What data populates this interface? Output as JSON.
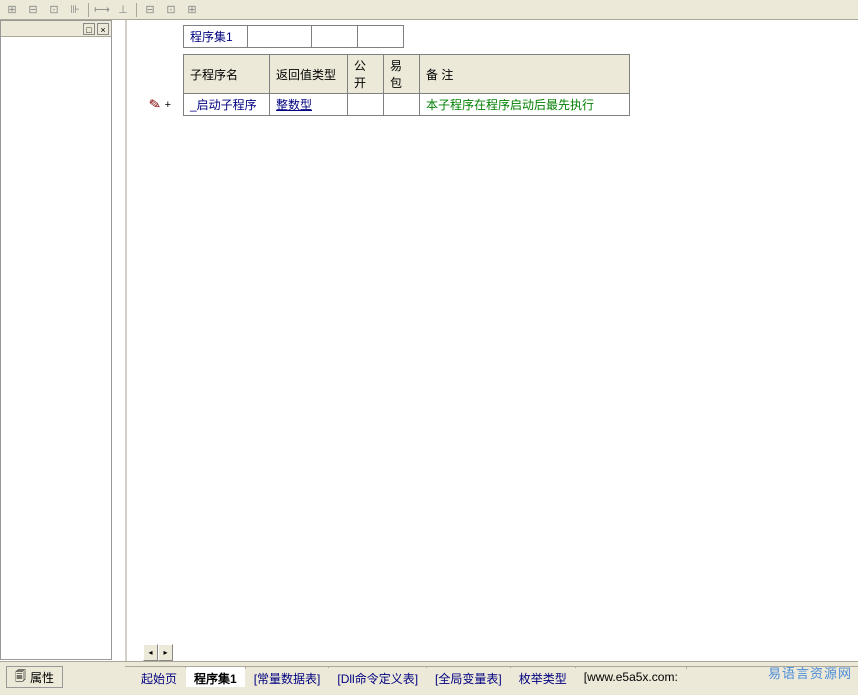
{
  "toolbar": {
    "icons": [
      "⊞",
      "⊟",
      "⊡",
      "⊪",
      "⟼",
      "⊥",
      " ",
      "⊟",
      "⊡",
      "⊞"
    ]
  },
  "left_panel": {
    "dock_label": "□",
    "close_label": "×"
  },
  "properties": {
    "label": "属性"
  },
  "module_table": {
    "title": "程序集1"
  },
  "sub_table": {
    "headers": {
      "name": "子程序名",
      "return_type": "返回值类型",
      "public": "公开",
      "easy_pkg": "易包",
      "remark": "备  注"
    },
    "row": {
      "name": "_启动子程序",
      "return_type": "整数型",
      "public": "",
      "easy_pkg": "",
      "remark": "本子程序在程序启动后最先执行"
    }
  },
  "gutter": {
    "plus": "+"
  },
  "tabs": {
    "t1": "起始页",
    "t2": "程序集1",
    "t3": "[常量数据表]",
    "t4": "[Dll命令定义表]",
    "t5": "[全局变量表]",
    "t6": "枚举类型",
    "t7": "[www.e5a5x.com:"
  },
  "watermark": "易语言资源网",
  "scroll": {
    "left": "◂",
    "right": "▸"
  }
}
